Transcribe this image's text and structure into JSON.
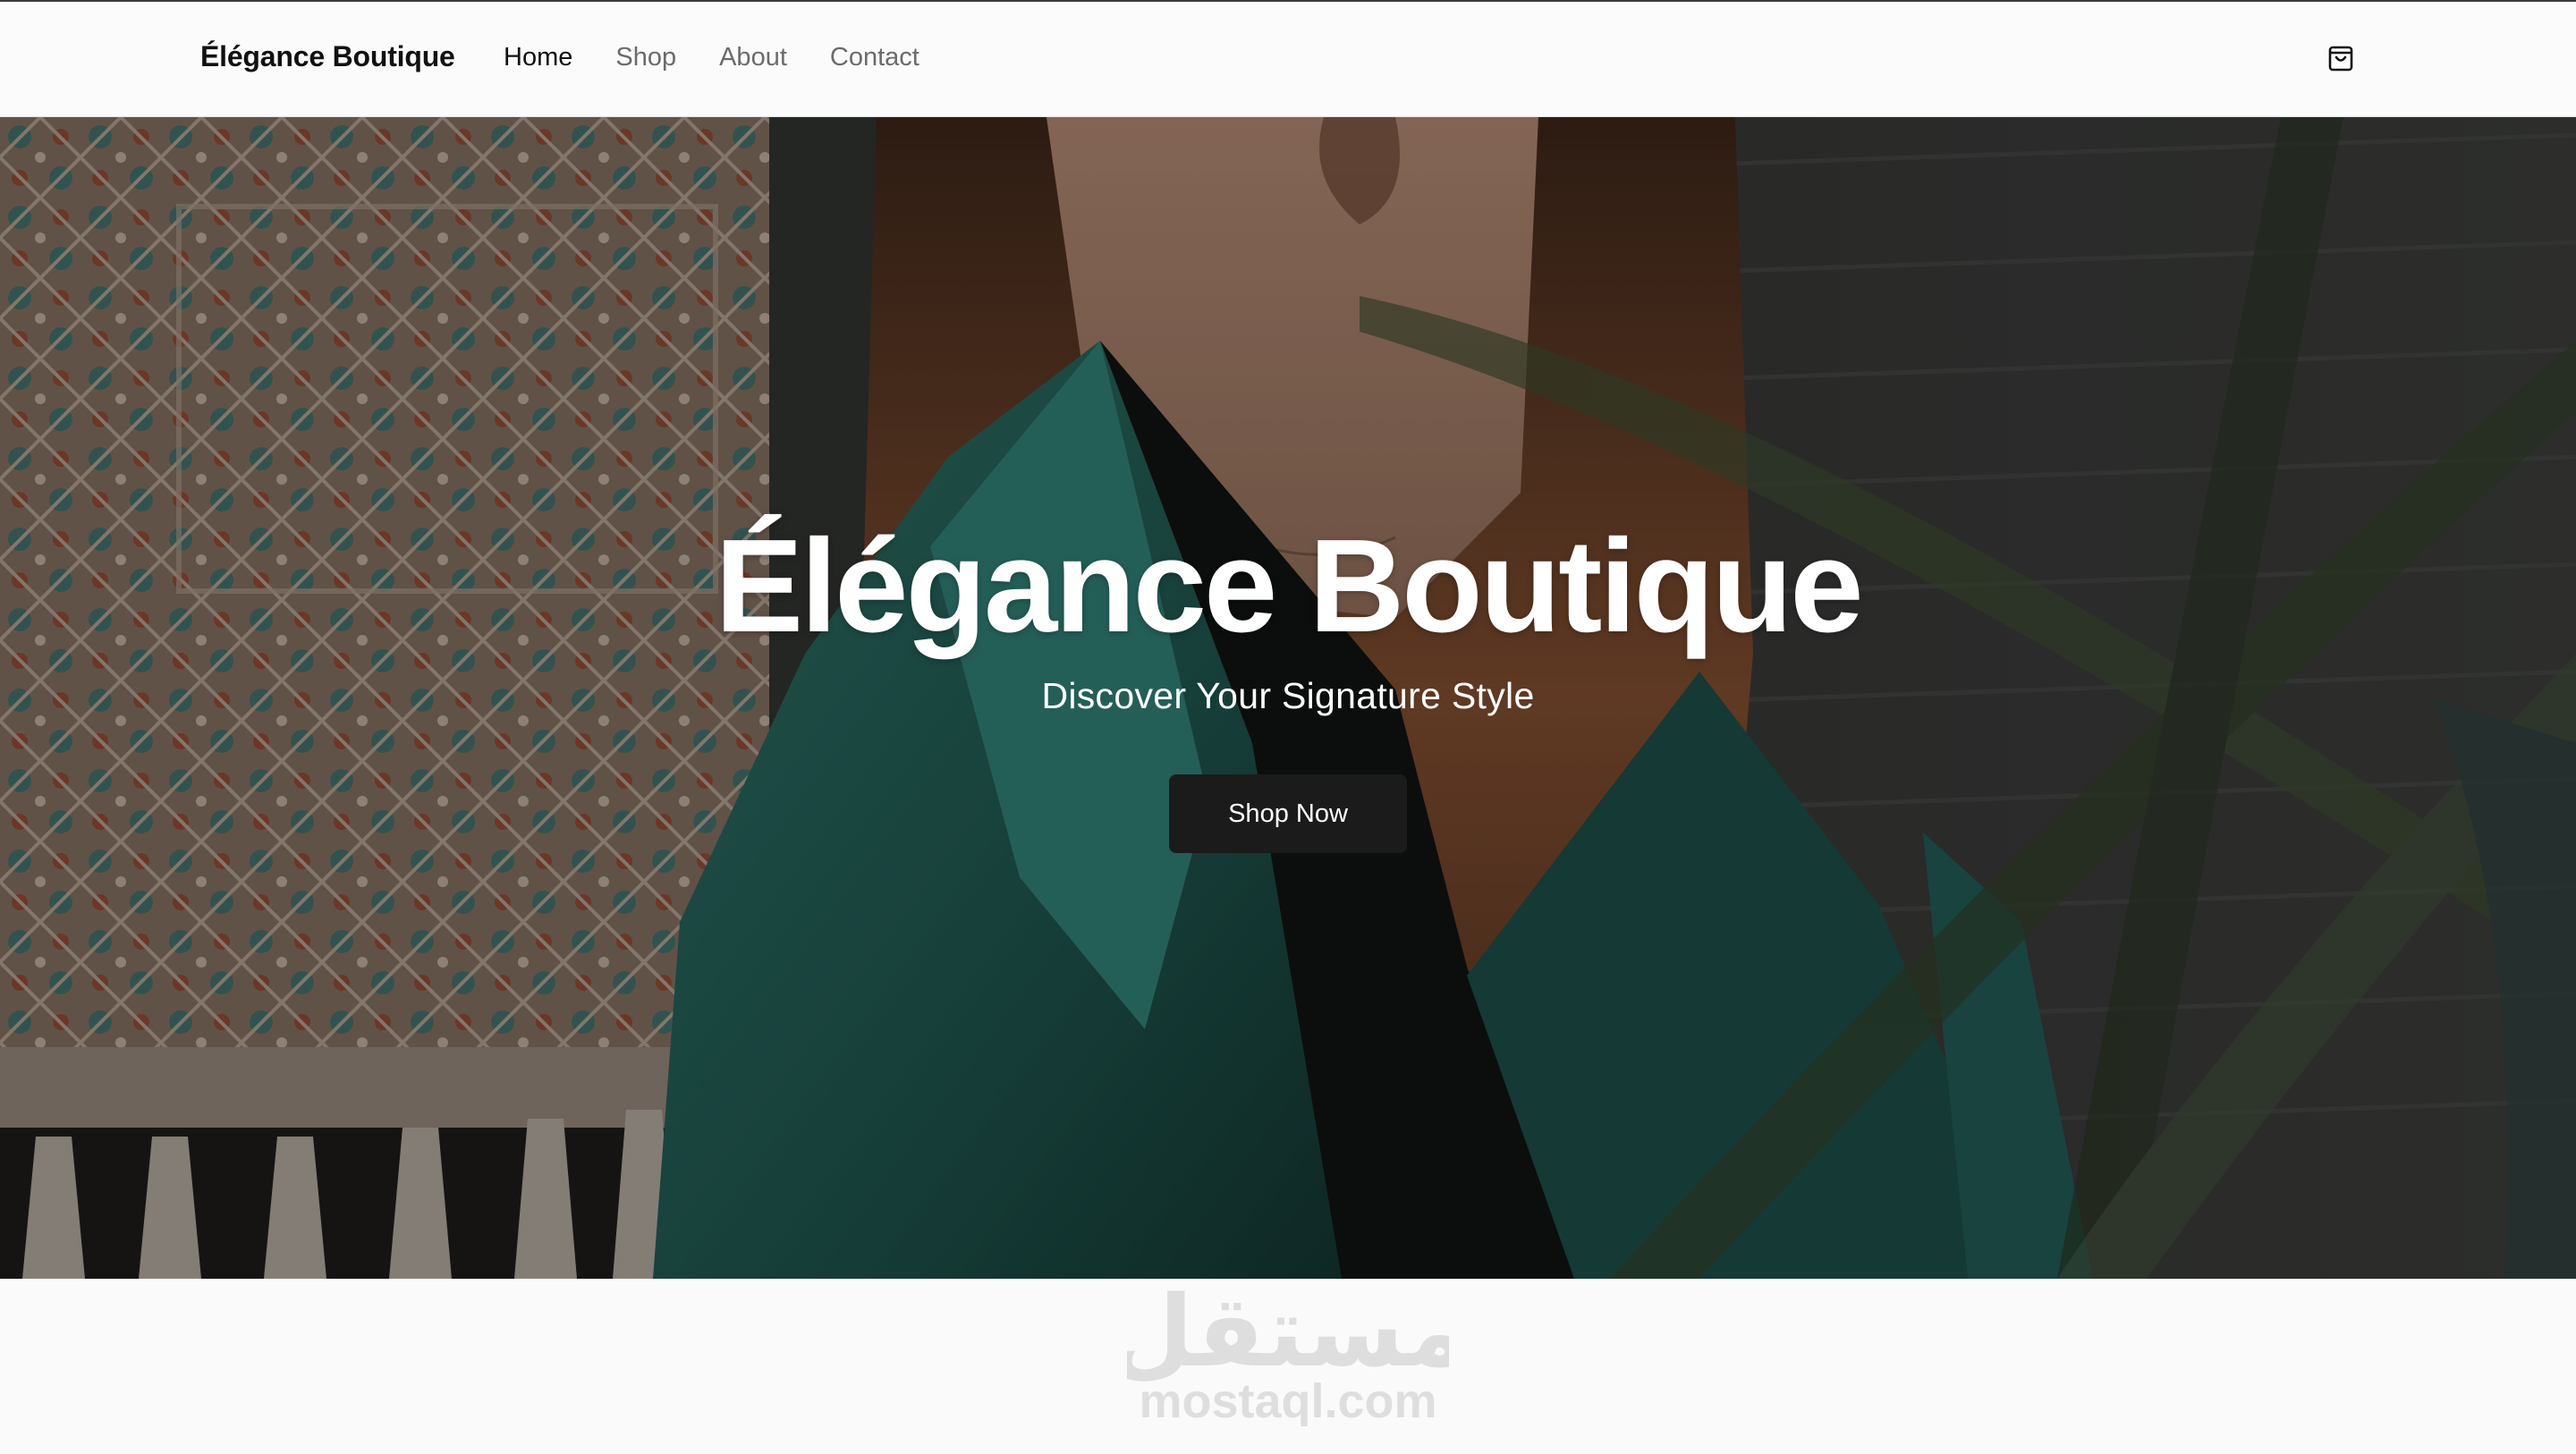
{
  "nav": {
    "brand": "Élégance Boutique",
    "links": [
      {
        "label": "Home",
        "active": true
      },
      {
        "label": "Shop",
        "active": false
      },
      {
        "label": "About",
        "active": false
      },
      {
        "label": "Contact",
        "active": false
      }
    ],
    "cart_icon": "shopping-bag-icon"
  },
  "hero": {
    "title": "Élégance Boutique",
    "subtitle": "Discover Your Signature Style",
    "cta_label": "Shop Now"
  },
  "watermark": {
    "arabic_text": "مستقل",
    "domain_text": "mostaql.com"
  },
  "colors": {
    "page_background": "#fafafa",
    "button_background": "#1b1b1b",
    "active_nav": "#111111",
    "inactive_nav": "#6b6b6b",
    "jacket_teal": "#1f5a52"
  }
}
